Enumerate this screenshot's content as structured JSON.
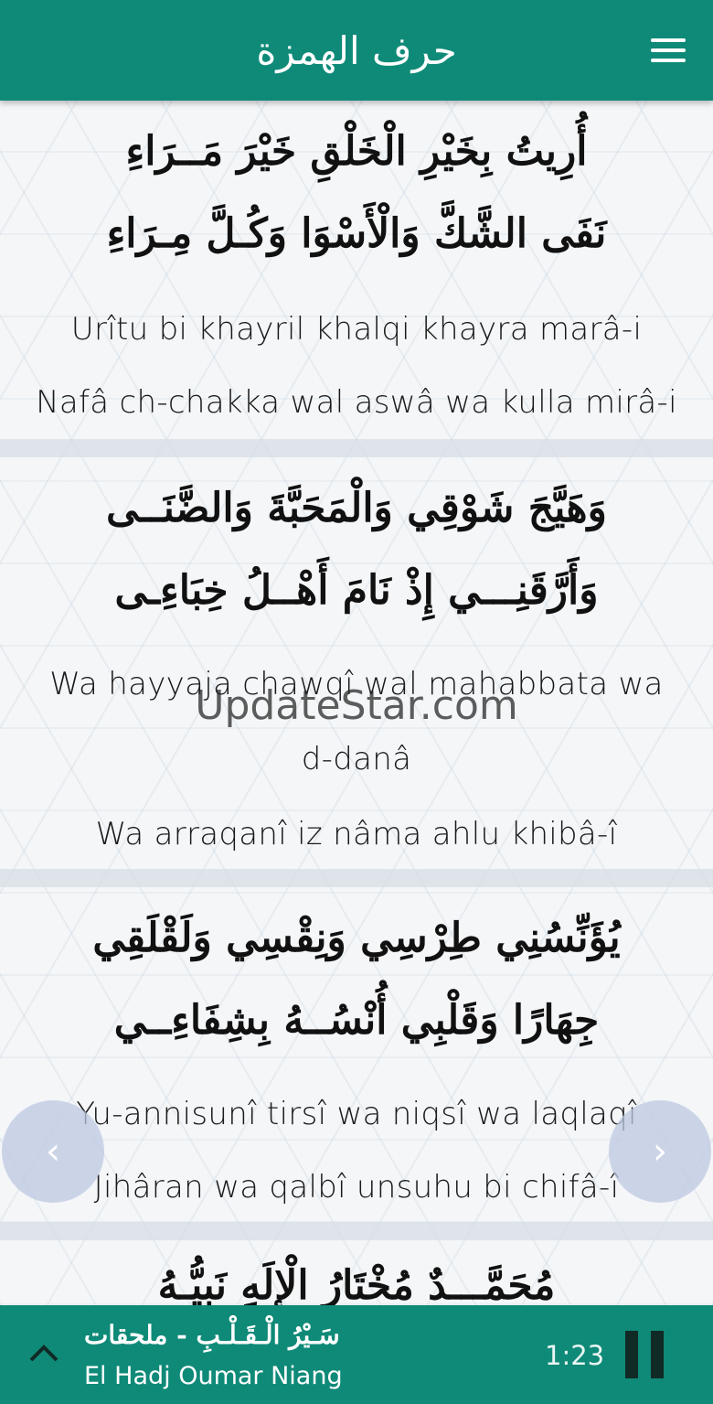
{
  "header": {
    "title": "حرف الهمزة",
    "menu_icon": "hamburger-menu-icon"
  },
  "verses": [
    {
      "arabic_1": "أُرِيتُ بِخَيْرِ الْخَلْقِ خَيْرَ مَــرَاءِ",
      "arabic_2": "نَفَى الشَّكَّ وَالْأَسْوَا وَكُـلَّ مِـرَاءِ",
      "translit_1": "Urîtu bi khayril khalqi khayra marâ-i",
      "translit_2": "Nafâ ch-chakka wal aswâ wa kulla mirâ-i"
    },
    {
      "arabic_1": "وَهَيَّجَ شَوْقِي وَالْمَحَبَّةَ وَالضَّنَــى",
      "arabic_2": "وَأَرَّقَنِـــي إِذْ نَامَ أَهْــلُ خِبَاءِـى",
      "translit_1": "Wa hayyaja chawqî wal mahabbata wa",
      "translit_1b": "d-danâ",
      "translit_2": "Wa arraqanî iz nâma ahlu khibâ-î"
    },
    {
      "arabic_1": "يُؤَنِّسُنِي طِرْسِي وَنِقْسِي وَلَقْلَقِي",
      "arabic_2": "جِهَارًا وَقَلْبِي أُنْسُــهُ بِشِفَاءِــي",
      "translit_1": "Yu-annisunî tirsî wa niqsî wa laqlaqî",
      "translit_2": "Jihâran wa qalbî unsuhu bi chifâ-î"
    },
    {
      "arabic_1": "مُحَمَّـــدٌ مُخْتَارُ الْإِلَهِ نَبِيُّـهُ"
    }
  ],
  "watermark": "UpdateStar.com",
  "nav": {
    "prev_label": "‹",
    "next_label": "›"
  },
  "player": {
    "title": "سَـيْرُ الْـقَـلْـبِ - ملحقات",
    "artist": "El Hadj Oumar Niang",
    "time": "1:23"
  },
  "colors": {
    "primary": "#0f8a78",
    "text": "#111111",
    "nav_button": "#bec8e1"
  }
}
